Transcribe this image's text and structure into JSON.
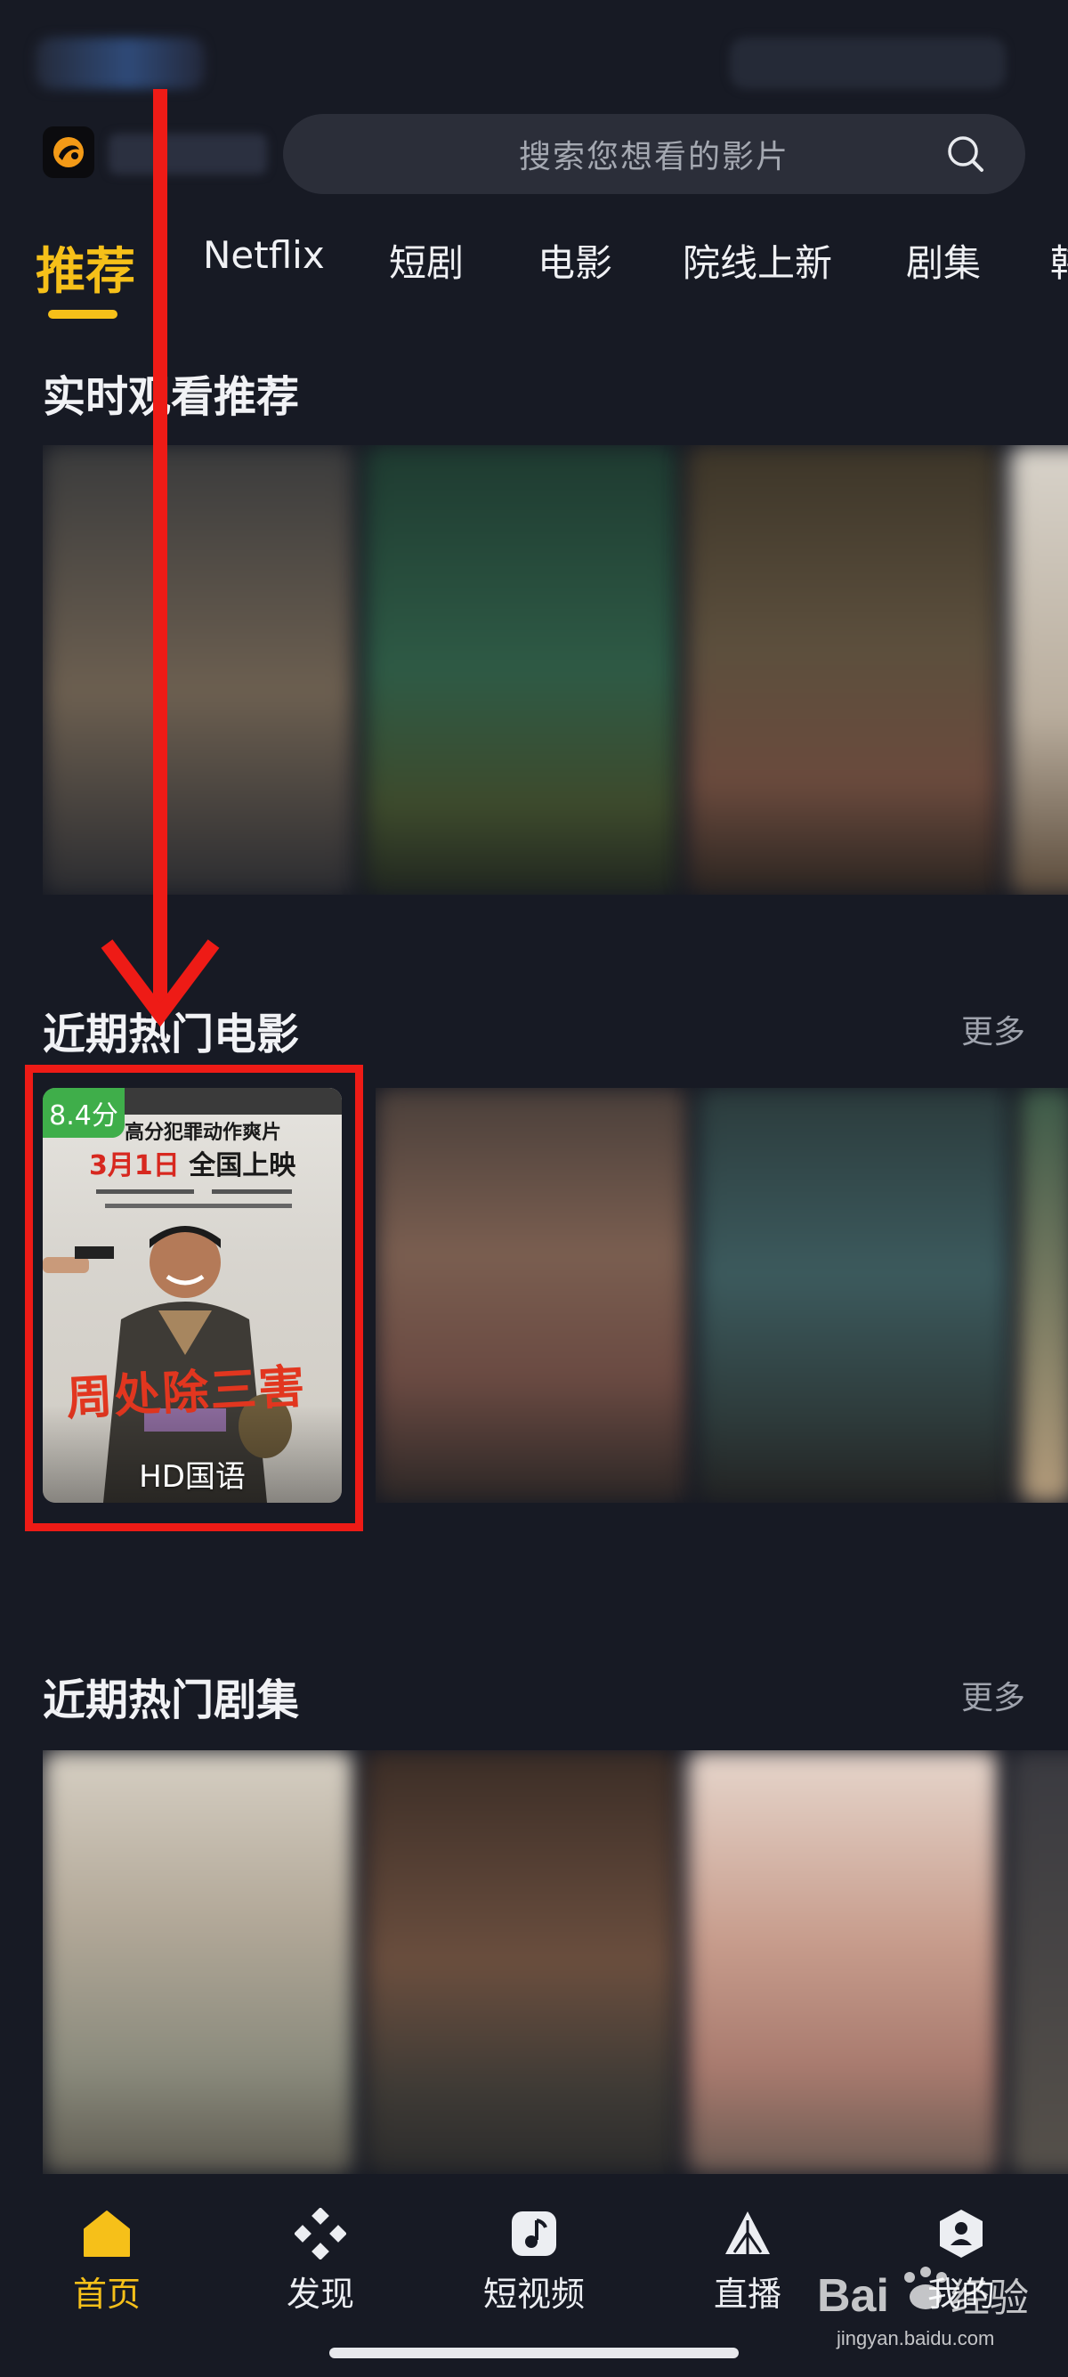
{
  "header": {
    "search_placeholder": "搜索您想看的影片"
  },
  "tabs": [
    {
      "label": "推荐",
      "active": true
    },
    {
      "label": "Netflix"
    },
    {
      "label": "短剧"
    },
    {
      "label": "电影"
    },
    {
      "label": "院线上新"
    },
    {
      "label": "剧集"
    },
    {
      "label": "韩"
    }
  ],
  "sections": {
    "realtime": {
      "title": "实时观看推荐"
    },
    "hot_movies": {
      "title": "近期热门电影",
      "more": "更多",
      "featured": {
        "score": "8.4分",
        "tagline": "高分犯罪动作爽片",
        "date_a": "3月1日",
        "date_b": "全国上映",
        "poster_title": "周处除三害",
        "quality": "HD国语"
      }
    },
    "hot_series": {
      "title": "近期热门剧集",
      "more": "更多"
    }
  },
  "bottom_nav": [
    {
      "label": "首页",
      "icon": "home-icon",
      "active": true
    },
    {
      "label": "发现",
      "icon": "discover-icon"
    },
    {
      "label": "短视频",
      "icon": "short-video-icon"
    },
    {
      "label": "直播",
      "icon": "live-icon"
    },
    {
      "label": "我的",
      "icon": "profile-icon"
    }
  ],
  "watermark": {
    "brand": "Baidu",
    "suffix": "经验",
    "url": "jingyan.baidu.com"
  },
  "colors": {
    "accent": "#f6c019",
    "background": "#171a24",
    "score_badge": "#3fae4a",
    "annotation": "#ee1b16"
  }
}
